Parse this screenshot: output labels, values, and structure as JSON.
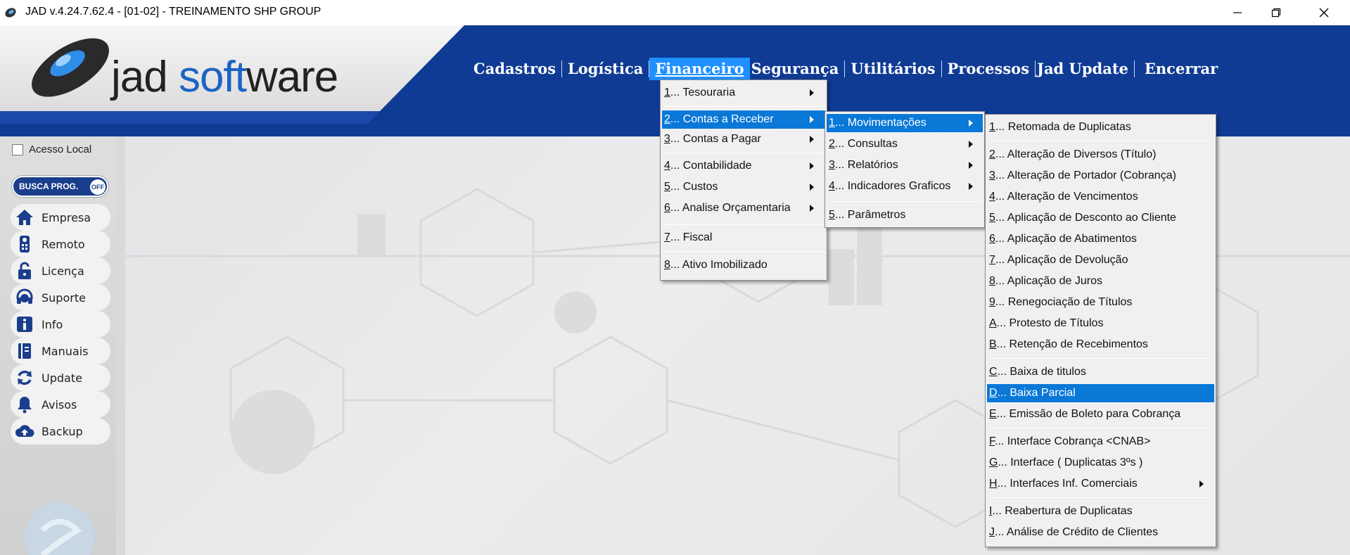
{
  "window": {
    "title": "JAD v.4.24.7.62.4 - [01-02] - TREINAMENTO SHP GROUP",
    "minimize_icon": "minimize-icon",
    "maximize_icon": "restore-icon",
    "close_icon": "close-icon"
  },
  "logo": {
    "part1": "jad ",
    "part2": "soft",
    "part3": "ware"
  },
  "menubar": [
    "Cadastros",
    "Logística",
    "Financeiro",
    "Segurança",
    "Utilitários",
    "Processos",
    "Jad Update",
    "Encerrar"
  ],
  "sidebar": {
    "acesso_local": "Acesso Local",
    "busca": "BUSCA PROG.",
    "busca_state": "OFF",
    "buttons": [
      "Empresa",
      "Remoto",
      "Licença",
      "Suporte",
      "Info",
      "Manuais",
      "Update",
      "Avisos",
      "Backup"
    ]
  },
  "financeiro_menu": [
    {
      "key": "1",
      "label": "... Tesouraria"
    },
    {
      "key": "2",
      "label": "... Contas a Receber"
    },
    {
      "key": "3",
      "label": "... Contas a Pagar"
    },
    {
      "key": "4",
      "label": "... Contabilidade"
    },
    {
      "key": "5",
      "label": "... Custos"
    },
    {
      "key": "6",
      "label": "... Analise Orçamentaria"
    },
    {
      "key": "7",
      "label": "... Fiscal"
    },
    {
      "key": "8",
      "label": "... Ativo Imobilizado"
    }
  ],
  "contas_receber_menu": [
    {
      "key": "1",
      "label": "... Movimentações"
    },
    {
      "key": "2",
      "label": "... Consultas"
    },
    {
      "key": "3",
      "label": "... Relatórios"
    },
    {
      "key": "4",
      "label": "... Indicadores Graficos"
    },
    {
      "key": "5",
      "label": "... Parâmetros"
    }
  ],
  "movimentacoes_menu": [
    {
      "key": "1",
      "label": "... Retomada de Duplicatas"
    },
    {
      "key": "2",
      "label": "... Alteração de Diversos (Título)"
    },
    {
      "key": "3",
      "label": "... Alteração de Portador (Cobrança)"
    },
    {
      "key": "4",
      "label": "... Alteração de Vencimentos"
    },
    {
      "key": "5",
      "label": "... Aplicação de Desconto ao Cliente"
    },
    {
      "key": "6",
      "label": "... Aplicação de Abatimentos"
    },
    {
      "key": "7",
      "label": "... Aplicação de Devolução"
    },
    {
      "key": "8",
      "label": "... Aplicação de Juros"
    },
    {
      "key": "9",
      "label": "... Renegociação de Títulos"
    },
    {
      "key": "A",
      "label": "... Protesto de Títulos"
    },
    {
      "key": "B",
      "label": "... Retenção de Recebimentos"
    },
    {
      "key": "C",
      "label": "... Baixa de titulos"
    },
    {
      "key": "D",
      "label": "... Baixa Parcial"
    },
    {
      "key": "E",
      "label": "... Emissão de Boleto para Cobrança"
    },
    {
      "key": "F",
      "label": "... Interface Cobrança <CNAB>"
    },
    {
      "key": "G",
      "label": "... Interface ( Duplicatas 3ºs )"
    },
    {
      "key": "H",
      "label": "... Interfaces Inf. Comerciais"
    },
    {
      "key": "I",
      "label": "... Reabertura de Duplicatas"
    },
    {
      "key": "J",
      "label": "... Análise de Crédito de Clientes"
    }
  ],
  "colors": {
    "header": "#0f3b94",
    "highlight": "#0a78d7",
    "menubar_active": "#1e90ff"
  }
}
